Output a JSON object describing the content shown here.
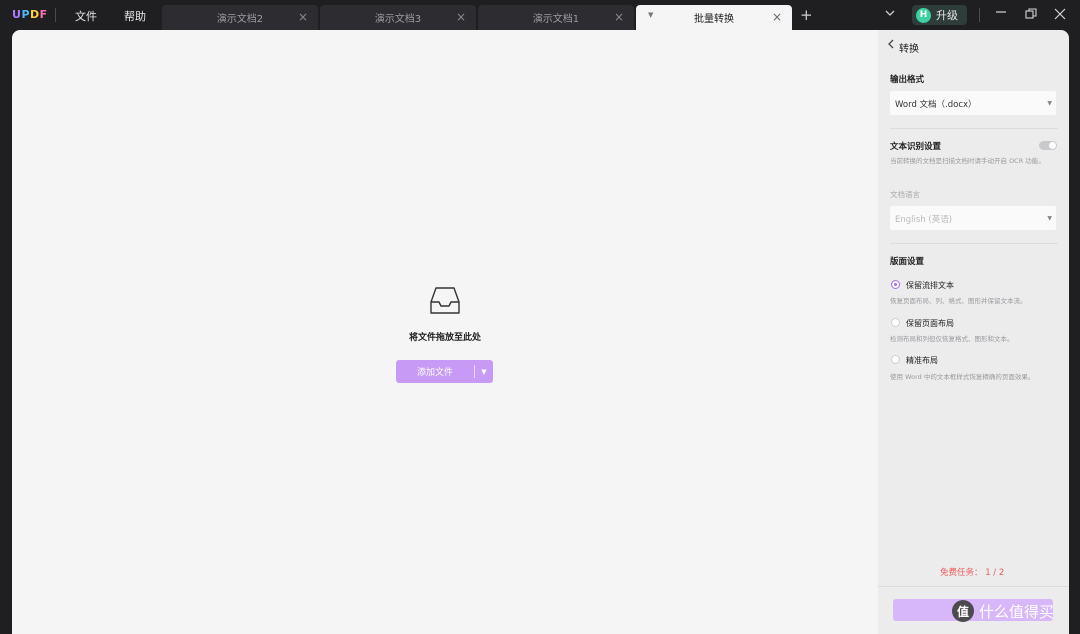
{
  "app": {
    "logo": "UPDF"
  },
  "menu": {
    "file": "文件",
    "help": "帮助"
  },
  "tabs": [
    {
      "label": "演示文档2",
      "active": false
    },
    {
      "label": "演示文档3",
      "active": false
    },
    {
      "label": "演示文档1",
      "active": false
    },
    {
      "label": "批量转换",
      "active": true
    }
  ],
  "tab_close_glyph": "×",
  "new_tab_glyph": "+",
  "upgrade": {
    "avatar_letter": "H",
    "label": "升级"
  },
  "main": {
    "drop_hint": "将文件拖放至此处",
    "add_button": "添加文件"
  },
  "panel": {
    "title": "转换",
    "output_format": {
      "section_title": "输出格式",
      "selected": "Word 文档（.docx）"
    },
    "ocr": {
      "section_title": "文本识别设置",
      "enabled": false,
      "description": "当前转换的文档是扫描文档时请手动开启 OCR 功能。",
      "language_label": "文档语言",
      "language_selected": "English (英语)"
    },
    "layout": {
      "section_title": "版面设置",
      "options": [
        {
          "label": "保留流排文本",
          "description": "恢复页面布局、列、格式、图形并保留文本流。",
          "selected": true
        },
        {
          "label": "保留页面布局",
          "description": "检测布局和列但仅恢复格式、图形和文本。",
          "selected": false
        },
        {
          "label": "精准布局",
          "description": "使用 Word 中的文本框样式恢复精确的页面效果。",
          "selected": false
        }
      ]
    },
    "free_tasks": "免费任务： 1 / 2"
  },
  "watermark": {
    "circle": "值",
    "text": "什么值得买"
  },
  "colors": {
    "accent": "#a66bef",
    "button": "#c79bf5",
    "warning": "#ef5a5a"
  }
}
